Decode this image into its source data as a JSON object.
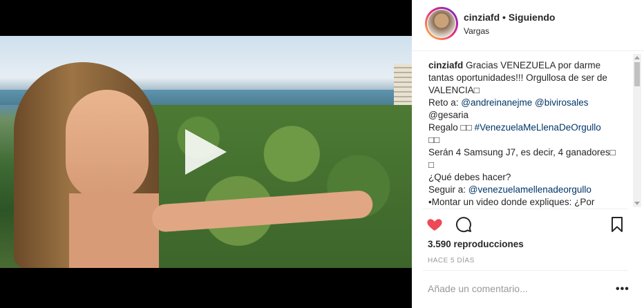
{
  "post": {
    "username": "cinziafd",
    "follow_status": "Siguiendo",
    "separator": " • ",
    "location": "Vargas",
    "caption_lines": [
      [
        "cinziafd",
        " Gracias VENEZUELA por darme"
      ],
      "tantas oportunidades!!! Orgullosa de ser de",
      "VALENCIA□",
      [
        "Reto a: ",
        "@andreinanejme @bivirosales"
      ],
      "@gesaria",
      [
        "Regalo □□ ",
        "#VenezuelaMeLlenaDeOrgullo"
      ],
      "□□",
      "Serán 4 Samsung J7, es decir, 4 ganadores□",
      "□",
      "¿Qué debes hacer?",
      [
        "Seguir a: ",
        "@venezuelamellenadeorgullo"
      ],
      "•Montar un video donde expliques: ¿Por"
    ],
    "views": "3.590 reproducciones",
    "time_ago": "HACE 5 DÍAS",
    "comment_placeholder": "Añade un comentario...",
    "more_label": "•••"
  },
  "icons": {
    "play": "play-icon",
    "like": "heart-icon",
    "comment": "comment-icon",
    "save": "bookmark-icon"
  },
  "colors": {
    "like": "#ed4956",
    "link": "#003569",
    "text": "#262626",
    "muted": "#999999"
  }
}
